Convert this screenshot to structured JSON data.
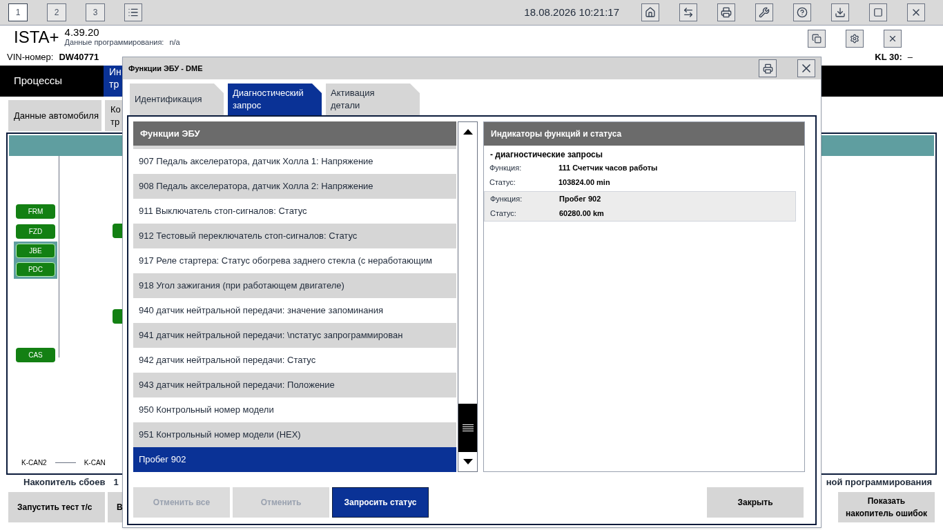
{
  "top_bar": {
    "workspaces": [
      {
        "label": "1",
        "selected": true
      },
      {
        "label": "2",
        "selected": false
      },
      {
        "label": "3",
        "selected": false
      }
    ],
    "datetime": "18.08.2026 10:21:17"
  },
  "header": {
    "app": "ISTA+",
    "version": "4.39.20",
    "programming_label": "Данные программирования:",
    "programming_value": "n/a"
  },
  "vehicle": {
    "vin_label": "VIN-номер:",
    "vin": "DW40771",
    "kl30_label": "KL 30:",
    "kl30_value": "–"
  },
  "nav": {
    "main": "Процессы",
    "partial_tab": [
      "Ин",
      "тр"
    ]
  },
  "subtabs": [
    {
      "label": "Данные автомобиля"
    },
    {
      "label": "Ко\nтр"
    }
  ],
  "ecus": [
    {
      "label": "FRM",
      "highlighted": false
    },
    {
      "label": "FZD",
      "highlighted": false
    },
    {
      "label": "JBE",
      "highlighted": true
    },
    {
      "label": "PDC",
      "highlighted": true
    },
    {
      "label": "CAS",
      "highlighted": false
    }
  ],
  "bus_legend": [
    "K-CAN2",
    "K-CAN"
  ],
  "fault_memory": {
    "label": "Накопитель сбоев",
    "count": "1"
  },
  "bottom_buttons": [
    {
      "label": "Запустить тест т/с"
    },
    {
      "label": "В"
    }
  ],
  "programming_note": "ной программирования",
  "show_faults_button": "Показать\nнакопитель ошибок",
  "dialog": {
    "title": "Функции ЭБУ - DME",
    "tabs": [
      {
        "label": "Идентификация",
        "selected": false
      },
      {
        "label": "Диагностический\nзапрос",
        "selected": true
      },
      {
        "label": "Активация\nдетали",
        "selected": false
      }
    ],
    "list_title": "Функции ЭБУ",
    "functions": [
      {
        "label": "907 Педаль акселератора, датчик Холла 1: Напряжение",
        "selected": false
      },
      {
        "label": "908 Педаль акселератора, датчик Холла 2: Напряжение",
        "selected": false
      },
      {
        "label": "911 Выключатель стоп-сигналов: Статус",
        "selected": false
      },
      {
        "label": "912 Тестовый переключатель стоп-сигналов: Статус",
        "selected": false
      },
      {
        "label": "917 Реле стартера: Статус обогрева заднего стекла (с неработающим",
        "selected": false
      },
      {
        "label": "918 Угол зажигания (при работающем двигателе)",
        "selected": false
      },
      {
        "label": "940 датчик нейтральной передачи: значение запоминания",
        "selected": false
      },
      {
        "label": "941 датчик нейтральной передачи: \\nстатус запрограммирован",
        "selected": false
      },
      {
        "label": "942 датчик нейтральной передачи: Статус",
        "selected": false
      },
      {
        "label": "943 датчик нейтральной передачи: Положение",
        "selected": false
      },
      {
        "label": "950 Контрольный номер модели",
        "selected": false
      },
      {
        "label": "951 Контрольный номер модели (HEX)",
        "selected": false
      },
      {
        "label": "Пробег 902",
        "selected": true
      }
    ],
    "status_title": "Индикаторы функций и статуса",
    "status_group": "- диагностические запросы",
    "results": [
      {
        "function_label": "Функция:",
        "function": "111 Счетчик часов работы",
        "status_label": "Статус:",
        "status": "103824.00 min",
        "selected": false
      },
      {
        "function_label": "Функция:",
        "function": "Пробег 902",
        "status_label": "Статус:",
        "status": "60280.00 km",
        "selected": true
      }
    ],
    "buttons": [
      {
        "label": "Отменить все",
        "disabled": true
      },
      {
        "label": "Отменить",
        "disabled": true
      },
      {
        "label": "Запросить статус",
        "disabled": false
      }
    ],
    "close_button": "Закрыть"
  }
}
